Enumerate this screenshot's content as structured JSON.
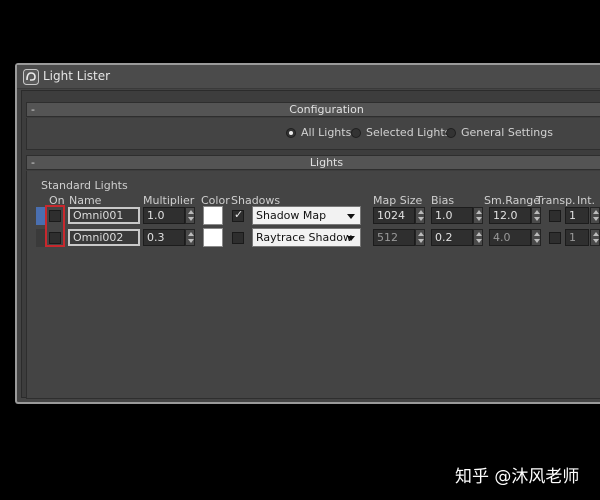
{
  "window": {
    "title": "Light Lister",
    "icon": "3ds-max-logo-icon"
  },
  "configuration": {
    "title": "Configuration",
    "collapse_symbol": "-",
    "options": [
      {
        "label": "All Lights",
        "selected": true
      },
      {
        "label": "Selected Lights",
        "selected": false
      },
      {
        "label": "General Settings",
        "selected": false
      }
    ]
  },
  "lights": {
    "title": "Lights",
    "collapse_symbol": "-",
    "group_label": "Standard Lights",
    "columns": {
      "on": "On",
      "name": "Name",
      "multiplier": "Multiplier",
      "color": "Color",
      "shadows": "Shadows",
      "map_size": "Map Size",
      "bias": "Bias",
      "sm_range": "Sm.Range",
      "transp": "Transp.",
      "int": "Int."
    },
    "rows": [
      {
        "on": false,
        "name": "Omni001",
        "multiplier": "1.0",
        "color": "#ffffff",
        "shadows_on": true,
        "shadow_type": "Shadow Map",
        "map_size": "1024",
        "bias": "1.0",
        "sm_range": "12.0",
        "transp": false,
        "int": "1",
        "strip_color": "#4a6fb0"
      },
      {
        "on": false,
        "name": "Omni002",
        "multiplier": "0.3",
        "color": "#ffffff",
        "shadows_on": false,
        "shadow_type": "Raytrace Shadow",
        "map_size": "512",
        "bias": "0.2",
        "sm_range": "4.0",
        "transp": false,
        "int": "1",
        "strip_color": "#3a3a3a"
      }
    ]
  },
  "watermark": "知乎 @沐风老师"
}
